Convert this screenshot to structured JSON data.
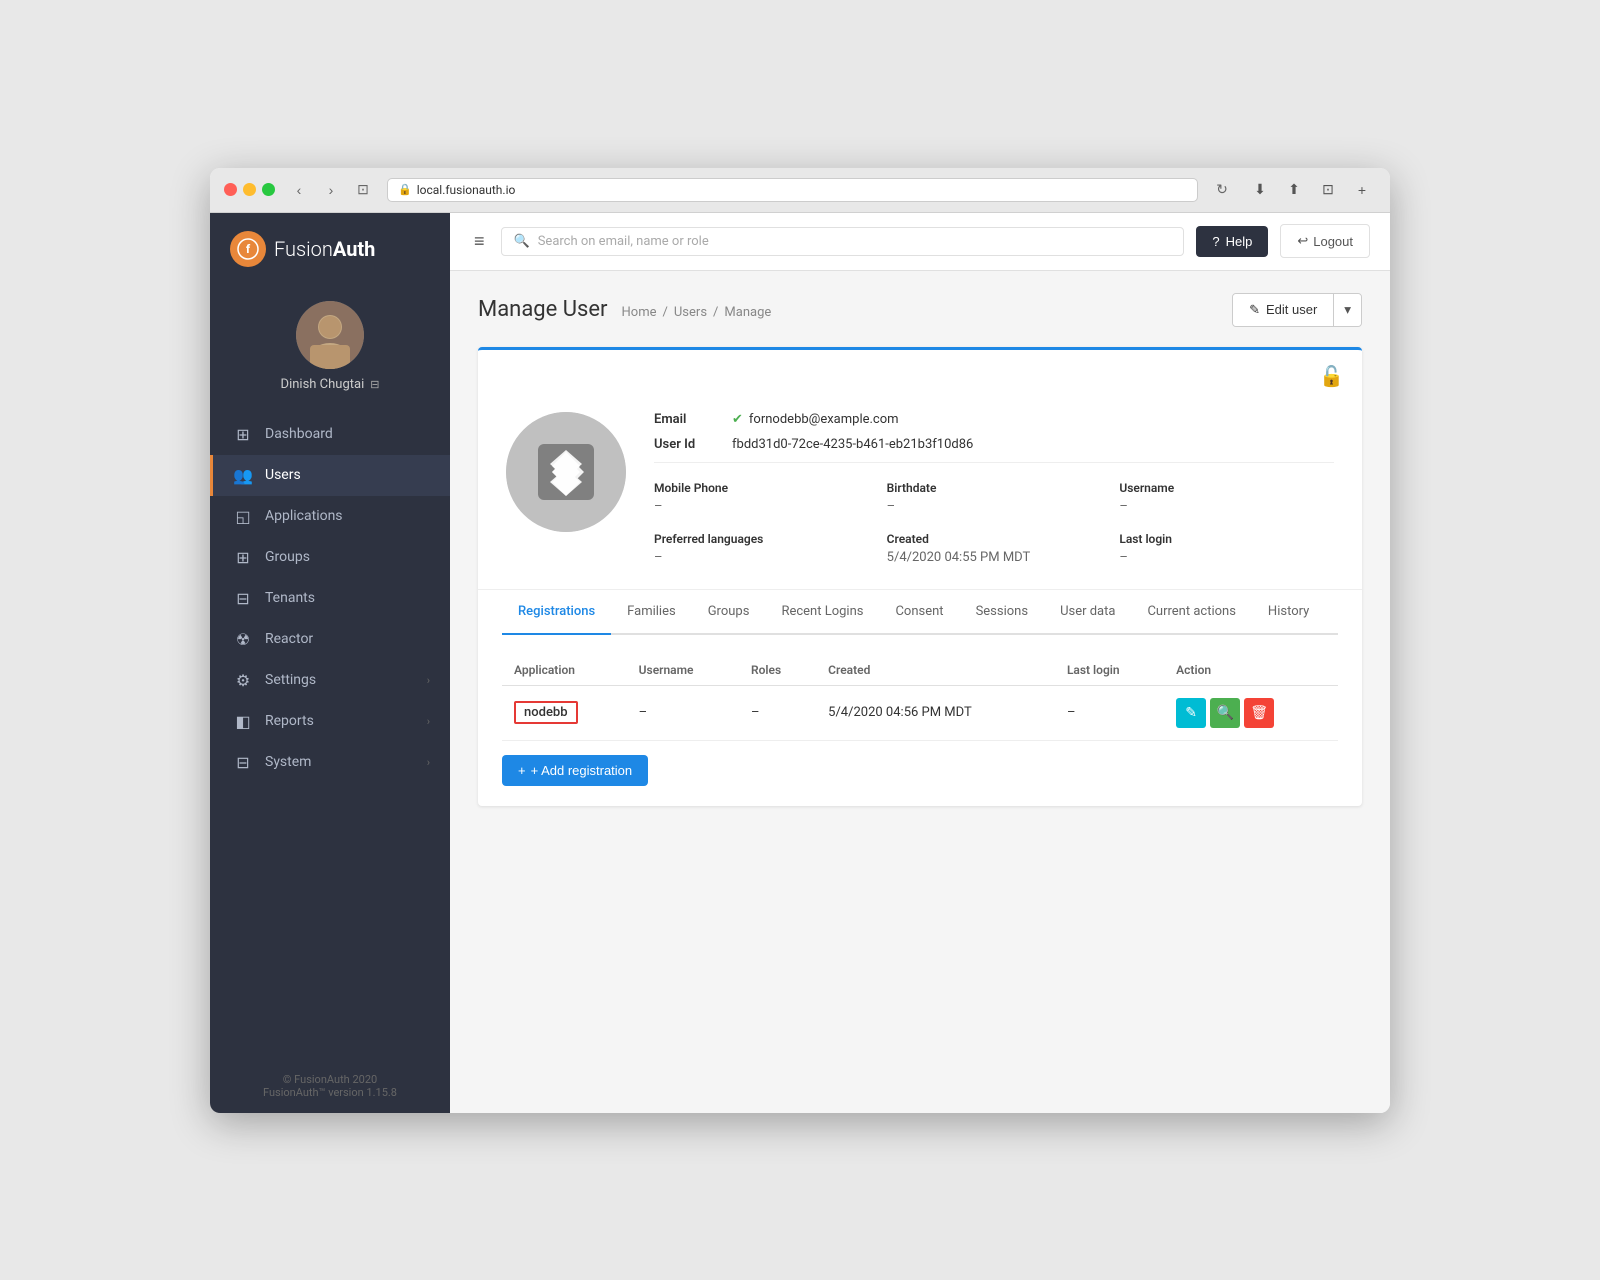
{
  "browser": {
    "url": "local.fusionauth.io",
    "tab_title": "local.fusionauth.io"
  },
  "app": {
    "name_prefix": "Fusion",
    "name_suffix": "Auth"
  },
  "sidebar": {
    "profile": {
      "name": "Dinish Chugtai"
    },
    "menu_items": [
      {
        "id": "dashboard",
        "label": "Dashboard",
        "icon": "⊞",
        "active": false
      },
      {
        "id": "users",
        "label": "Users",
        "icon": "👥",
        "active": true
      },
      {
        "id": "applications",
        "label": "Applications",
        "icon": "◱",
        "active": false
      },
      {
        "id": "groups",
        "label": "Groups",
        "icon": "⊞",
        "active": false
      },
      {
        "id": "tenants",
        "label": "Tenants",
        "icon": "⊟",
        "active": false
      },
      {
        "id": "reactor",
        "label": "Reactor",
        "icon": "☢",
        "active": false
      },
      {
        "id": "settings",
        "label": "Settings",
        "icon": "⊞",
        "active": false,
        "has_arrow": true
      },
      {
        "id": "reports",
        "label": "Reports",
        "icon": "◧",
        "active": false,
        "has_arrow": true
      },
      {
        "id": "system",
        "label": "System",
        "icon": "⊟",
        "active": false,
        "has_arrow": true
      }
    ],
    "footer": {
      "line1": "© FusionAuth 2020",
      "line2": "FusionAuth™ version 1.15.8"
    }
  },
  "topbar": {
    "search_placeholder": "Search on email, name or role",
    "help_label": "Help",
    "logout_label": "Logout"
  },
  "page": {
    "title": "Manage User",
    "breadcrumb": [
      "Home",
      "Users",
      "Manage"
    ],
    "edit_button_label": "Edit user"
  },
  "user": {
    "email": "fornodebb@example.com",
    "email_verified": true,
    "user_id": "fbdd31d0-72ce-4235-b461-eb21b3f10d86",
    "mobile_phone": "–",
    "birthdate": "–",
    "username": "–",
    "preferred_languages": "–",
    "created": "5/4/2020 04:55 PM MDT",
    "last_login": "–"
  },
  "tabs": {
    "items": [
      {
        "id": "registrations",
        "label": "Registrations",
        "active": true
      },
      {
        "id": "families",
        "label": "Families",
        "active": false
      },
      {
        "id": "groups",
        "label": "Groups",
        "active": false
      },
      {
        "id": "recent-logins",
        "label": "Recent Logins",
        "active": false
      },
      {
        "id": "consent",
        "label": "Consent",
        "active": false
      },
      {
        "id": "sessions",
        "label": "Sessions",
        "active": false
      },
      {
        "id": "user-data",
        "label": "User data",
        "active": false
      },
      {
        "id": "current-actions",
        "label": "Current actions",
        "active": false
      },
      {
        "id": "history",
        "label": "History",
        "active": false
      }
    ]
  },
  "registrations_table": {
    "columns": [
      "Application",
      "Username",
      "Roles",
      "Created",
      "Last login",
      "Action"
    ],
    "rows": [
      {
        "application": "nodebb",
        "username": "–",
        "roles": "–",
        "created": "5/4/2020 04:56 PM MDT",
        "last_login": "–"
      }
    ],
    "add_button_label": "+ Add registration"
  },
  "labels": {
    "email": "Email",
    "user_id": "User Id",
    "mobile_phone": "Mobile Phone",
    "birthdate": "Birthdate",
    "username": "Username",
    "preferred_languages": "Preferred languages",
    "created": "Created",
    "last_login": "Last login"
  }
}
